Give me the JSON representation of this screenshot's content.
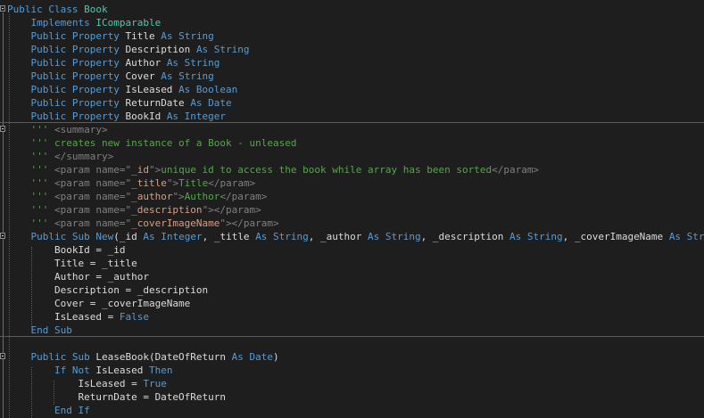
{
  "colors": {
    "background": "#1e1e1e",
    "keyword": "#569cd6",
    "type": "#4ec9b0",
    "comment": "#57a64a",
    "xml_delimiter": "#808080",
    "xml_attribute_value": "#d69d85",
    "plain": "#dcdcdc"
  },
  "lines": [
    [
      {
        "t": "Public Class ",
        "c": "kw"
      },
      {
        "t": "Book",
        "c": "ty"
      }
    ],
    [
      {
        "t": "    Implements ",
        "c": "kw"
      },
      {
        "t": "IComparable",
        "c": "ty"
      }
    ],
    [
      {
        "t": "    Public Property ",
        "c": "kw"
      },
      {
        "t": "Title ",
        "c": "pl"
      },
      {
        "t": "As String",
        "c": "kw"
      }
    ],
    [
      {
        "t": "    Public Property ",
        "c": "kw"
      },
      {
        "t": "Description ",
        "c": "pl"
      },
      {
        "t": "As String",
        "c": "kw"
      }
    ],
    [
      {
        "t": "    Public Property ",
        "c": "kw"
      },
      {
        "t": "Author ",
        "c": "pl"
      },
      {
        "t": "As String",
        "c": "kw"
      }
    ],
    [
      {
        "t": "    Public Property ",
        "c": "kw"
      },
      {
        "t": "Cover ",
        "c": "pl"
      },
      {
        "t": "As String",
        "c": "kw"
      }
    ],
    [
      {
        "t": "    Public Property ",
        "c": "kw"
      },
      {
        "t": "IsLeased ",
        "c": "pl"
      },
      {
        "t": "As Boolean",
        "c": "kw"
      }
    ],
    [
      {
        "t": "    Public Property ",
        "c": "kw"
      },
      {
        "t": "ReturnDate ",
        "c": "pl"
      },
      {
        "t": "As Date",
        "c": "kw"
      }
    ],
    [
      {
        "t": "    Public Property ",
        "c": "kw"
      },
      {
        "t": "BookId ",
        "c": "pl"
      },
      {
        "t": "As Integer",
        "c": "kw"
      }
    ],
    [
      {
        "t": "    ''' ",
        "c": "cm"
      },
      {
        "t": "<summary>",
        "c": "xt"
      }
    ],
    [
      {
        "t": "    ''' creates new instance of a Book - unleased",
        "c": "cm"
      }
    ],
    [
      {
        "t": "    ''' ",
        "c": "cm"
      },
      {
        "t": "</summary>",
        "c": "xt"
      }
    ],
    [
      {
        "t": "    ''' ",
        "c": "cm"
      },
      {
        "t": "<param name=\"",
        "c": "xt"
      },
      {
        "t": "_id",
        "c": "xv"
      },
      {
        "t": "\">",
        "c": "xt"
      },
      {
        "t": "unique id to access the book while array has been sorted",
        "c": "tx"
      },
      {
        "t": "</param>",
        "c": "xt"
      }
    ],
    [
      {
        "t": "    ''' ",
        "c": "cm"
      },
      {
        "t": "<param name=\"",
        "c": "xt"
      },
      {
        "t": "_title",
        "c": "xv"
      },
      {
        "t": "\">",
        "c": "xt"
      },
      {
        "t": "Title",
        "c": "tx"
      },
      {
        "t": "</param>",
        "c": "xt"
      }
    ],
    [
      {
        "t": "    ''' ",
        "c": "cm"
      },
      {
        "t": "<param name=\"",
        "c": "xt"
      },
      {
        "t": "_author",
        "c": "xv"
      },
      {
        "t": "\">",
        "c": "xt"
      },
      {
        "t": "Author",
        "c": "tx"
      },
      {
        "t": "</param>",
        "c": "xt"
      }
    ],
    [
      {
        "t": "    ''' ",
        "c": "cm"
      },
      {
        "t": "<param name=\"",
        "c": "xt"
      },
      {
        "t": "_description",
        "c": "xv"
      },
      {
        "t": "\"></param>",
        "c": "xt"
      }
    ],
    [
      {
        "t": "    ''' ",
        "c": "cm"
      },
      {
        "t": "<param name=\"",
        "c": "xt"
      },
      {
        "t": "_coverImageName",
        "c": "xv"
      },
      {
        "t": "\"></param>",
        "c": "xt"
      }
    ],
    [
      {
        "t": "    Public Sub New",
        "c": "kw"
      },
      {
        "t": "(_id ",
        "c": "pl"
      },
      {
        "t": "As Integer",
        "c": "kw"
      },
      {
        "t": ", _title ",
        "c": "pl"
      },
      {
        "t": "As String",
        "c": "kw"
      },
      {
        "t": ", _author ",
        "c": "pl"
      },
      {
        "t": "As String",
        "c": "kw"
      },
      {
        "t": ", _description ",
        "c": "pl"
      },
      {
        "t": "As String",
        "c": "kw"
      },
      {
        "t": ", _coverImageName ",
        "c": "pl"
      },
      {
        "t": "As String",
        "c": "kw"
      },
      {
        "t": ")",
        "c": "pl"
      }
    ],
    [
      {
        "t": "        BookId = _id",
        "c": "pl"
      }
    ],
    [
      {
        "t": "        Title = _title",
        "c": "pl"
      }
    ],
    [
      {
        "t": "        Author = _author",
        "c": "pl"
      }
    ],
    [
      {
        "t": "        Description = _description",
        "c": "pl"
      }
    ],
    [
      {
        "t": "        Cover = _coverImageName",
        "c": "pl"
      }
    ],
    [
      {
        "t": "        IsLeased = ",
        "c": "pl"
      },
      {
        "t": "False",
        "c": "kw"
      }
    ],
    [
      {
        "t": "    End Sub",
        "c": "kw"
      }
    ],
    [
      {
        "t": "",
        "c": "pl"
      }
    ],
    [
      {
        "t": "    Public Sub ",
        "c": "kw"
      },
      {
        "t": "LeaseBook(DateOfReturn ",
        "c": "pl"
      },
      {
        "t": "As Date",
        "c": "kw"
      },
      {
        "t": ")",
        "c": "pl"
      }
    ],
    [
      {
        "t": "        If Not ",
        "c": "kw"
      },
      {
        "t": "IsLeased ",
        "c": "pl"
      },
      {
        "t": "Then",
        "c": "kw"
      }
    ],
    [
      {
        "t": "            IsLeased = ",
        "c": "pl"
      },
      {
        "t": "True",
        "c": "kw"
      }
    ],
    [
      {
        "t": "            ReturnDate = DateOfReturn",
        "c": "pl"
      }
    ],
    [
      {
        "t": "        End If",
        "c": "kw"
      }
    ]
  ]
}
